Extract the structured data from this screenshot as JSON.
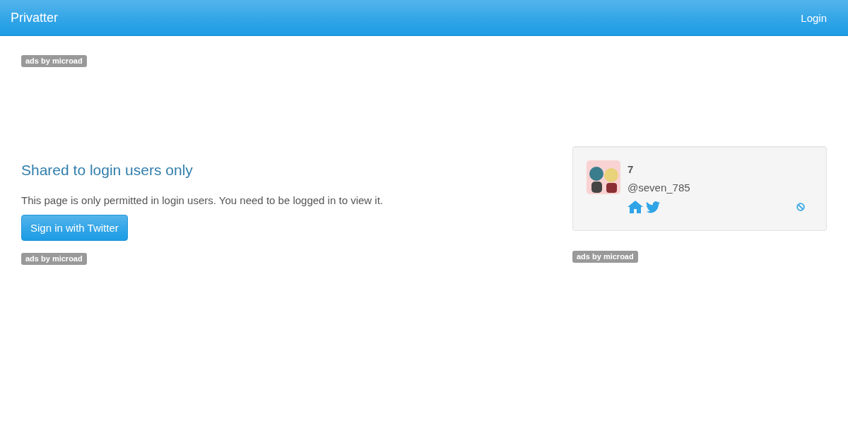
{
  "navbar": {
    "brand": "Privatter",
    "login": "Login"
  },
  "top_ad": {
    "label": "ads by microad"
  },
  "main": {
    "heading": "Shared to login users only",
    "message": "This page is only permitted in login users. You need to be logged in to view it.",
    "button": "Sign in with Twitter",
    "ad_label": "ads by microad"
  },
  "profile": {
    "name": "7",
    "handle": "@seven_785"
  },
  "side_ad": {
    "label": "ads by microad"
  }
}
